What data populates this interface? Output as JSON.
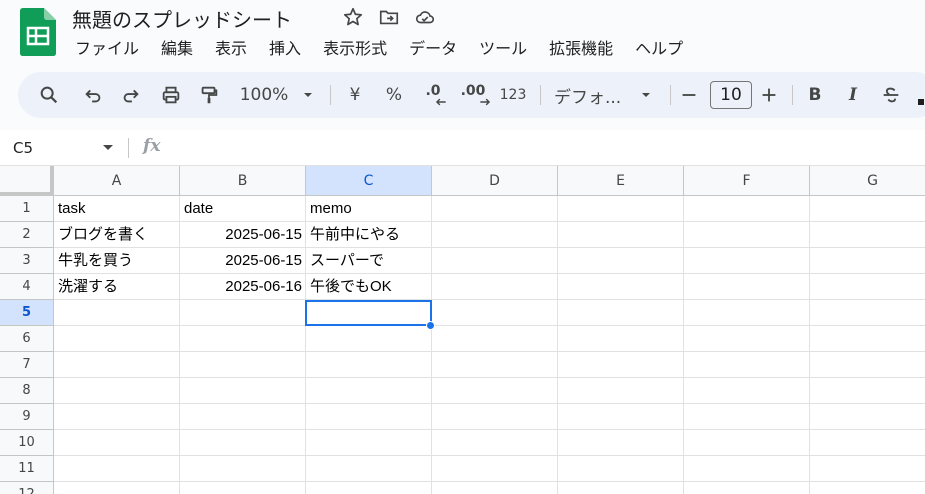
{
  "app": {
    "title": "無題のスプレッドシート"
  },
  "menu": [
    "ファイル",
    "編集",
    "表示",
    "挿入",
    "表示形式",
    "データ",
    "ツール",
    "拡張機能",
    "ヘルプ"
  ],
  "toolbar": {
    "zoom": "100%",
    "currency": "¥",
    "percent": "%",
    "decimal_decrease": ".0",
    "decimal_increase": ".00",
    "number_format": "123",
    "font": "デフォ...",
    "font_size": "10",
    "bold": "B",
    "italic": "I"
  },
  "formula_bar": {
    "name_box": "C5",
    "fx": "fx"
  },
  "columns": [
    "A",
    "B",
    "C",
    "D",
    "E",
    "F",
    "G"
  ],
  "selected_column": "C",
  "rows": [
    "1",
    "2",
    "3",
    "4",
    "5",
    "6",
    "7",
    "8",
    "9",
    "10",
    "11",
    "12"
  ],
  "selected_row": "5",
  "cells": {
    "A1": "task",
    "B1": "date",
    "C1": "memo",
    "A2": "ブログを書く",
    "B2": "2025-06-15",
    "C2": "午前中にやる",
    "A3": "牛乳を買う",
    "B3": "2025-06-15",
    "C3": "スーパーで",
    "A4": "洗濯する",
    "B4": "2025-06-16",
    "C4": "午後でもOK"
  },
  "colors": {
    "accent": "#1a73e8",
    "selected_header": "#d3e3fd",
    "logo": "#0f9d58"
  }
}
